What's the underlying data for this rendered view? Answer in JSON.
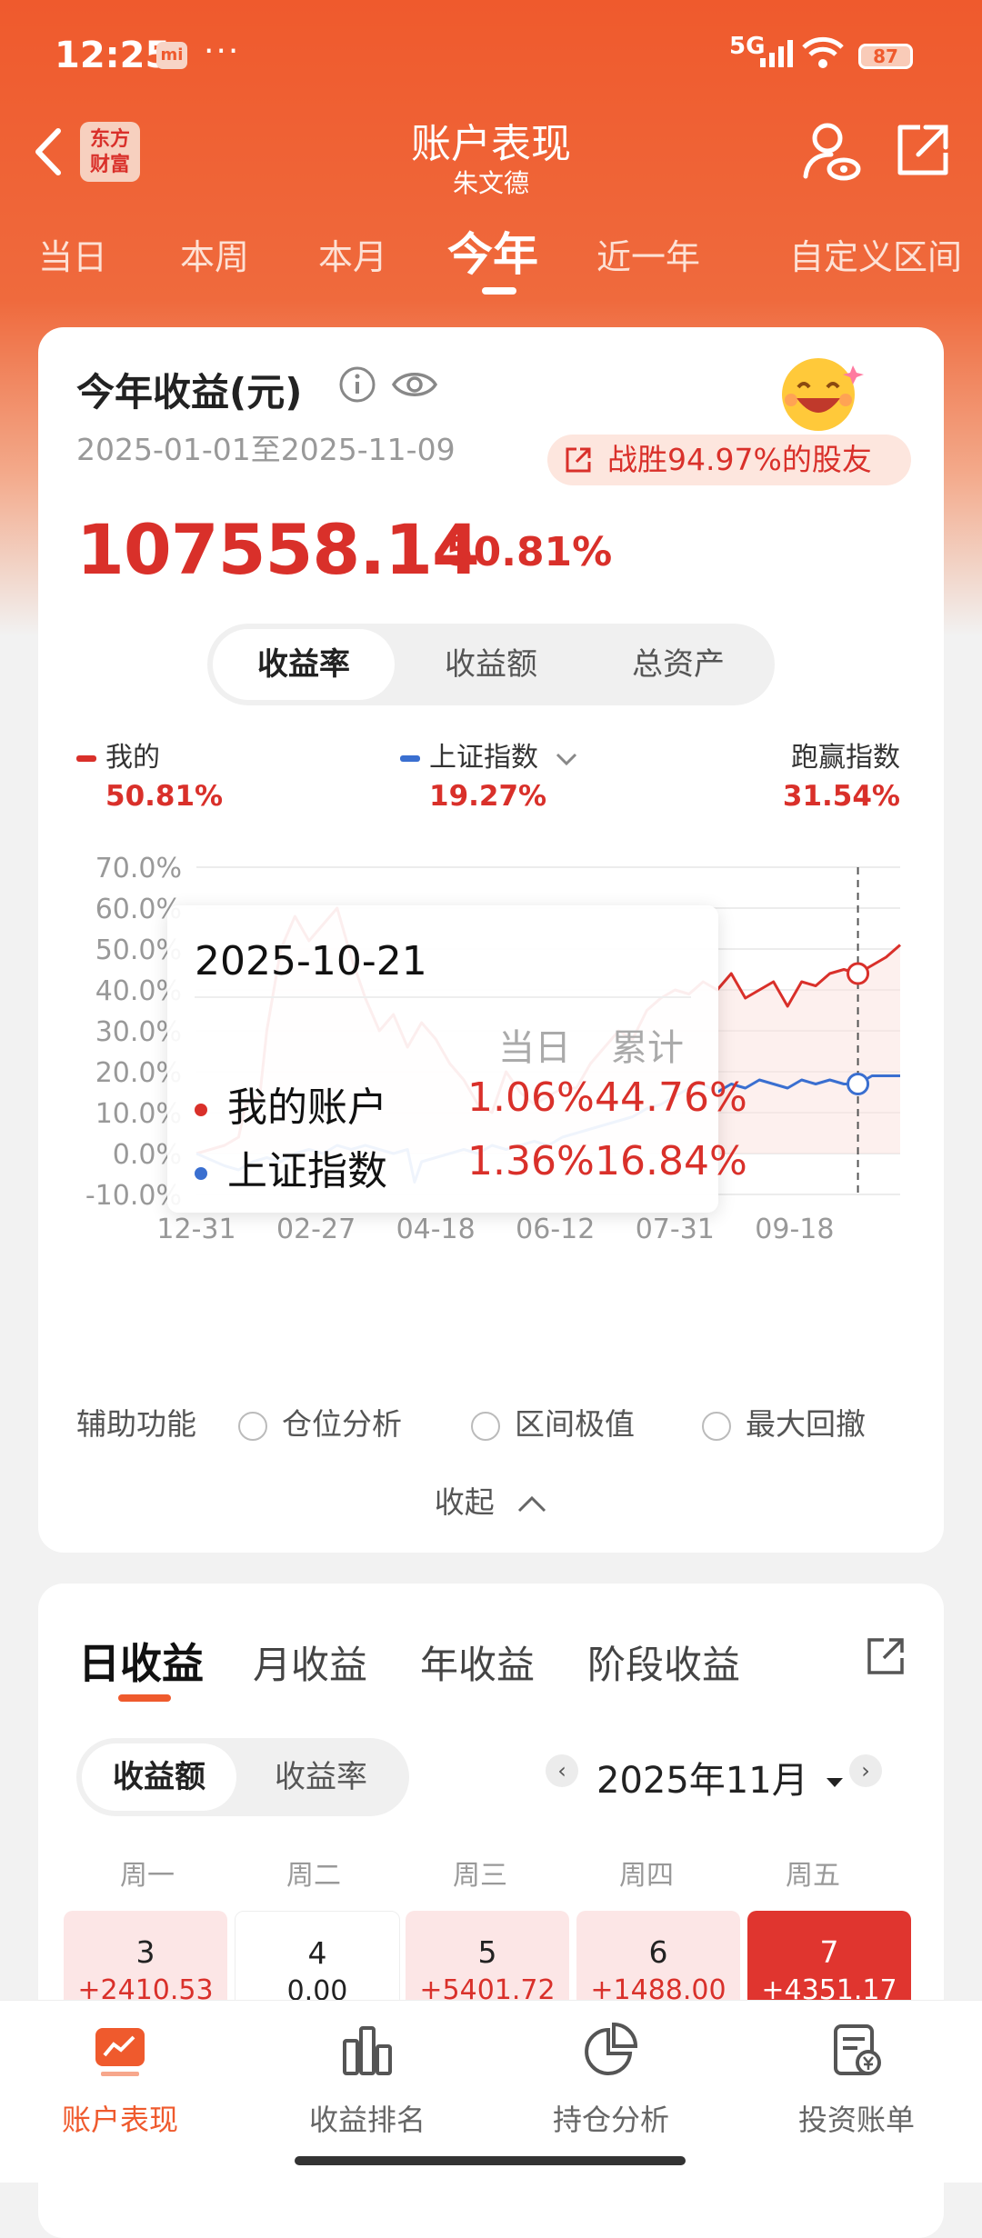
{
  "status_bar": {
    "time": "12:25",
    "mi_badge": "mi",
    "dots": "···",
    "network": "5G",
    "battery": "87"
  },
  "nav": {
    "title": "账户表现",
    "subtitle": "朱文德",
    "logo_text_1": "东方",
    "logo_text_2": "财富"
  },
  "period_tabs": [
    "当日",
    "本周",
    "本月",
    "今年",
    "近一年",
    "自定义区间"
  ],
  "period_active": "今年",
  "summary": {
    "title": "今年收益(元)",
    "date_range": "2025-01-01至2025-11-09",
    "badge": "战胜94.97%的股友",
    "amount": "107558.14",
    "percent": "50.81%"
  },
  "chart_tabs": [
    "收益率",
    "收益额",
    "总资产"
  ],
  "legend": {
    "mine_label": "我的",
    "mine_value": "50.81%",
    "index_label": "上证指数",
    "index_value": "19.27%",
    "outperform_label": "跑赢指数",
    "outperform_value": "31.54%"
  },
  "tooltip": {
    "date": "2025-10-21",
    "col_day": "当日",
    "col_total": "累计",
    "rows": [
      {
        "label": "我的账户",
        "day": "1.06%",
        "total": "44.76%"
      },
      {
        "label": "上证指数",
        "day": "1.36%",
        "total": "16.84%"
      }
    ]
  },
  "chart_data": {
    "type": "line",
    "x_ticks": [
      "12-31",
      "02-27",
      "04-18",
      "06-12",
      "07-31",
      "09-18"
    ],
    "y_ticks": [
      "70.0%",
      "60.0%",
      "50.0%",
      "40.0%",
      "30.0%",
      "20.0%",
      "10.0%",
      "0.0%",
      "-10.0%"
    ],
    "ylim": [
      -10,
      70
    ],
    "series": [
      {
        "name": "我的",
        "color": "#d9302a",
        "x": [
          0,
          4,
          6,
          7,
          8,
          9,
          10,
          12,
          14,
          16,
          18,
          20,
          22,
          24,
          26,
          28,
          30,
          32,
          34,
          36,
          38,
          40,
          42,
          44,
          46,
          48,
          50,
          52,
          54,
          56,
          58,
          60,
          62,
          64,
          66,
          68,
          70,
          72,
          74,
          76,
          78,
          80,
          82,
          84,
          86,
          88,
          90,
          92,
          94,
          96,
          98,
          100
        ],
        "values": [
          0,
          2,
          4,
          12,
          13,
          14,
          30,
          50,
          58,
          52,
          56,
          60,
          48,
          38,
          30,
          34,
          26,
          32,
          28,
          22,
          18,
          12,
          10,
          20,
          15,
          12,
          14,
          16,
          16,
          22,
          26,
          30,
          28,
          35,
          38,
          40,
          39,
          42,
          40,
          44,
          38,
          40,
          42,
          36,
          42,
          41,
          44,
          45,
          44,
          46,
          48,
          51
        ]
      },
      {
        "name": "上证指数",
        "color": "#3a6fd0",
        "x": [
          0,
          4,
          6,
          8,
          10,
          12,
          14,
          16,
          18,
          20,
          22,
          24,
          26,
          28,
          30,
          31,
          32,
          34,
          36,
          38,
          40,
          42,
          44,
          46,
          48,
          50,
          52,
          54,
          56,
          58,
          60,
          62,
          64,
          66,
          68,
          70,
          72,
          74,
          76,
          78,
          80,
          82,
          84,
          86,
          88,
          90,
          92,
          94,
          96,
          98,
          100
        ],
        "values": [
          0,
          -3,
          -4,
          -2,
          -1,
          -2,
          0,
          1,
          0,
          2,
          1,
          2,
          1,
          0,
          1,
          -7,
          -2,
          -1,
          0,
          1,
          0,
          2,
          1,
          2,
          3,
          2,
          4,
          5,
          6,
          7,
          8,
          9,
          11,
          12,
          14,
          16,
          17,
          15,
          17,
          16,
          18,
          17,
          16,
          18,
          17,
          18,
          17,
          17,
          19,
          19,
          19
        ]
      }
    ],
    "highlight_x": 94
  },
  "aux": {
    "label": "辅助功能",
    "opt1": "仓位分析",
    "opt2": "区间极值",
    "opt3": "最大回撤"
  },
  "collapse": "收起",
  "income_tabs": [
    "日收益",
    "月收益",
    "年收益",
    "阶段收益"
  ],
  "income_seg": [
    "收益额",
    "收益率"
  ],
  "month": "2025年11月",
  "weekdays": [
    "周一",
    "周二",
    "周三",
    "周四",
    "周五"
  ],
  "days": [
    {
      "n": "3",
      "amt": "+2410.53"
    },
    {
      "n": "4",
      "amt": "0.00"
    },
    {
      "n": "5",
      "amt": "+5401.72"
    },
    {
      "n": "6",
      "amt": "+1488.00"
    },
    {
      "n": "7",
      "amt": "+4351.17"
    }
  ],
  "bottom_nav": [
    "账户表现",
    "收益排名",
    "持仓分析",
    "投资账单"
  ]
}
